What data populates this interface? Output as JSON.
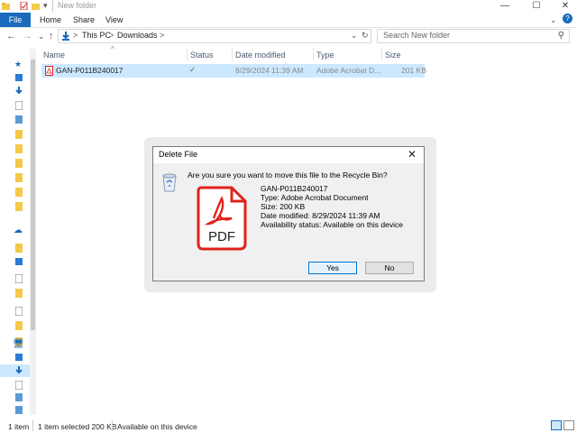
{
  "window": {
    "title": "New folder",
    "controls": {
      "minimize": "—",
      "maximize": "☐",
      "close": "✕"
    }
  },
  "ribbon": {
    "tabs": [
      "File",
      "Home",
      "Share",
      "View"
    ],
    "help_icon": "?"
  },
  "navigation": {
    "back": "←",
    "forward": "→",
    "recent": "⌄",
    "up": "↑",
    "breadcrumb": [
      "This PC",
      "Downloads"
    ],
    "separator": ">",
    "search_placeholder": "Search New folder"
  },
  "columns": [
    "Name",
    "Status",
    "Date modified",
    "Type",
    "Size"
  ],
  "files": [
    {
      "name": "GAN-P011B240017",
      "status": "✓",
      "date_modified": "8/29/2024 11:39 AM",
      "type": "Adobe Acrobat D...",
      "size": "201 KB"
    }
  ],
  "statusbar": {
    "item_count": "1 item",
    "selection": "1 item selected  200 KB",
    "availability": "Available on this device"
  },
  "dialog": {
    "title": "Delete File",
    "close": "✕",
    "question": "Are you sure you want to move this file to the Recycle Bin?",
    "file_icon_label": "PDF",
    "info": [
      "GAN-P011B240017",
      "Type: Adobe Acrobat Document",
      "Size: 200 KB",
      "Date modified: 8/29/2024 11:39 AM",
      "Availability status: Available on this device"
    ],
    "yes_label": "Yes",
    "no_label": "No"
  },
  "colors": {
    "accent": "#1a6bbd",
    "selection": "#cce8ff",
    "pdf_red": "#e0221b"
  }
}
